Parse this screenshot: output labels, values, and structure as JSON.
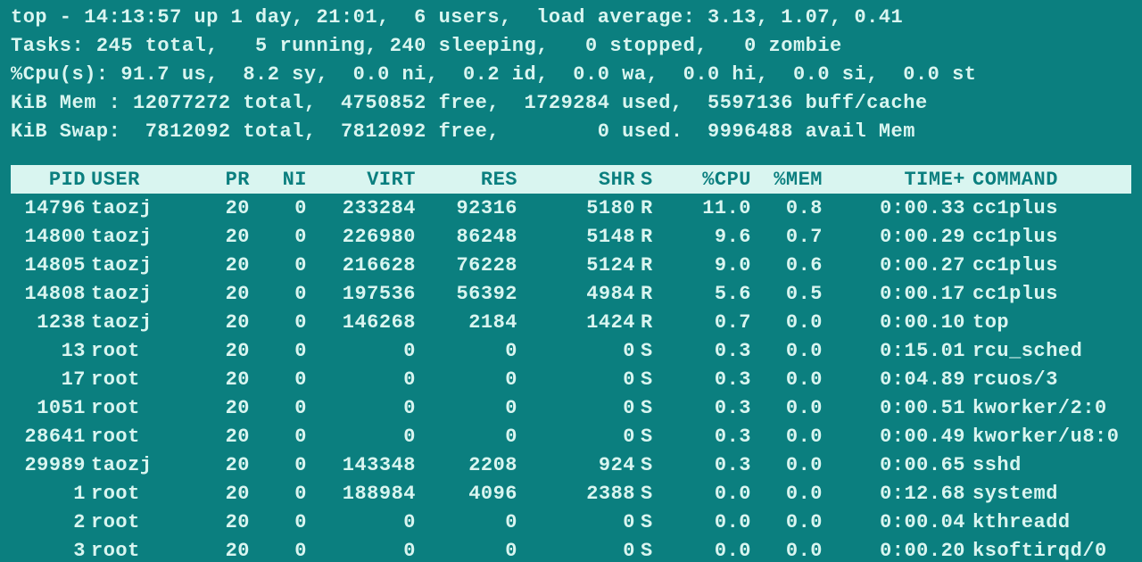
{
  "summary": {
    "line1": "top - 14:13:57 up 1 day, 21:01,  6 users,  load average: 3.13, 1.07, 0.41",
    "line2": "Tasks: 245 total,   5 running, 240 sleeping,   0 stopped,   0 zombie",
    "line3": "%Cpu(s): 91.7 us,  8.2 sy,  0.0 ni,  0.2 id,  0.0 wa,  0.0 hi,  0.0 si,  0.0 st",
    "line4": "KiB Mem : 12077272 total,  4750852 free,  1729284 used,  5597136 buff/cache",
    "line5": "KiB Swap:  7812092 total,  7812092 free,        0 used.  9996488 avail Mem"
  },
  "columns": {
    "pid": "  PID",
    "user": "USER",
    "pr": "PR",
    "ni": "NI",
    "virt": "VIRT",
    "res": "RES",
    "shr": "SHR",
    "s": "S",
    "cpu": "%CPU",
    "mem": "%MEM",
    "time": "TIME+",
    "cmd": "COMMAND"
  },
  "rows": [
    {
      "pid": "14796",
      "user": "taozj",
      "pr": "20",
      "ni": "0",
      "virt": "233284",
      "res": "92316",
      "shr": "5180",
      "s": "R",
      "cpu": "11.0",
      "mem": "0.8",
      "time": "0:00.33",
      "cmd": "cc1plus"
    },
    {
      "pid": "14800",
      "user": "taozj",
      "pr": "20",
      "ni": "0",
      "virt": "226980",
      "res": "86248",
      "shr": "5148",
      "s": "R",
      "cpu": "9.6",
      "mem": "0.7",
      "time": "0:00.29",
      "cmd": "cc1plus"
    },
    {
      "pid": "14805",
      "user": "taozj",
      "pr": "20",
      "ni": "0",
      "virt": "216628",
      "res": "76228",
      "shr": "5124",
      "s": "R",
      "cpu": "9.0",
      "mem": "0.6",
      "time": "0:00.27",
      "cmd": "cc1plus"
    },
    {
      "pid": "14808",
      "user": "taozj",
      "pr": "20",
      "ni": "0",
      "virt": "197536",
      "res": "56392",
      "shr": "4984",
      "s": "R",
      "cpu": "5.6",
      "mem": "0.5",
      "time": "0:00.17",
      "cmd": "cc1plus"
    },
    {
      "pid": "1238",
      "user": "taozj",
      "pr": "20",
      "ni": "0",
      "virt": "146268",
      "res": "2184",
      "shr": "1424",
      "s": "R",
      "cpu": "0.7",
      "mem": "0.0",
      "time": "0:00.10",
      "cmd": "top"
    },
    {
      "pid": "13",
      "user": "root",
      "pr": "20",
      "ni": "0",
      "virt": "0",
      "res": "0",
      "shr": "0",
      "s": "S",
      "cpu": "0.3",
      "mem": "0.0",
      "time": "0:15.01",
      "cmd": "rcu_sched"
    },
    {
      "pid": "17",
      "user": "root",
      "pr": "20",
      "ni": "0",
      "virt": "0",
      "res": "0",
      "shr": "0",
      "s": "S",
      "cpu": "0.3",
      "mem": "0.0",
      "time": "0:04.89",
      "cmd": "rcuos/3"
    },
    {
      "pid": "1051",
      "user": "root",
      "pr": "20",
      "ni": "0",
      "virt": "0",
      "res": "0",
      "shr": "0",
      "s": "S",
      "cpu": "0.3",
      "mem": "0.0",
      "time": "0:00.51",
      "cmd": "kworker/2:0"
    },
    {
      "pid": "28641",
      "user": "root",
      "pr": "20",
      "ni": "0",
      "virt": "0",
      "res": "0",
      "shr": "0",
      "s": "S",
      "cpu": "0.3",
      "mem": "0.0",
      "time": "0:00.49",
      "cmd": "kworker/u8:0"
    },
    {
      "pid": "29989",
      "user": "taozj",
      "pr": "20",
      "ni": "0",
      "virt": "143348",
      "res": "2208",
      "shr": "924",
      "s": "S",
      "cpu": "0.3",
      "mem": "0.0",
      "time": "0:00.65",
      "cmd": "sshd"
    },
    {
      "pid": "1",
      "user": "root",
      "pr": "20",
      "ni": "0",
      "virt": "188984",
      "res": "4096",
      "shr": "2388",
      "s": "S",
      "cpu": "0.0",
      "mem": "0.0",
      "time": "0:12.68",
      "cmd": "systemd"
    },
    {
      "pid": "2",
      "user": "root",
      "pr": "20",
      "ni": "0",
      "virt": "0",
      "res": "0",
      "shr": "0",
      "s": "S",
      "cpu": "0.0",
      "mem": "0.0",
      "time": "0:00.04",
      "cmd": "kthreadd"
    },
    {
      "pid": "3",
      "user": "root",
      "pr": "20",
      "ni": "0",
      "virt": "0",
      "res": "0",
      "shr": "0",
      "s": "S",
      "cpu": "0.0",
      "mem": "0.0",
      "time": "0:00.20",
      "cmd": "ksoftirqd/0"
    }
  ]
}
